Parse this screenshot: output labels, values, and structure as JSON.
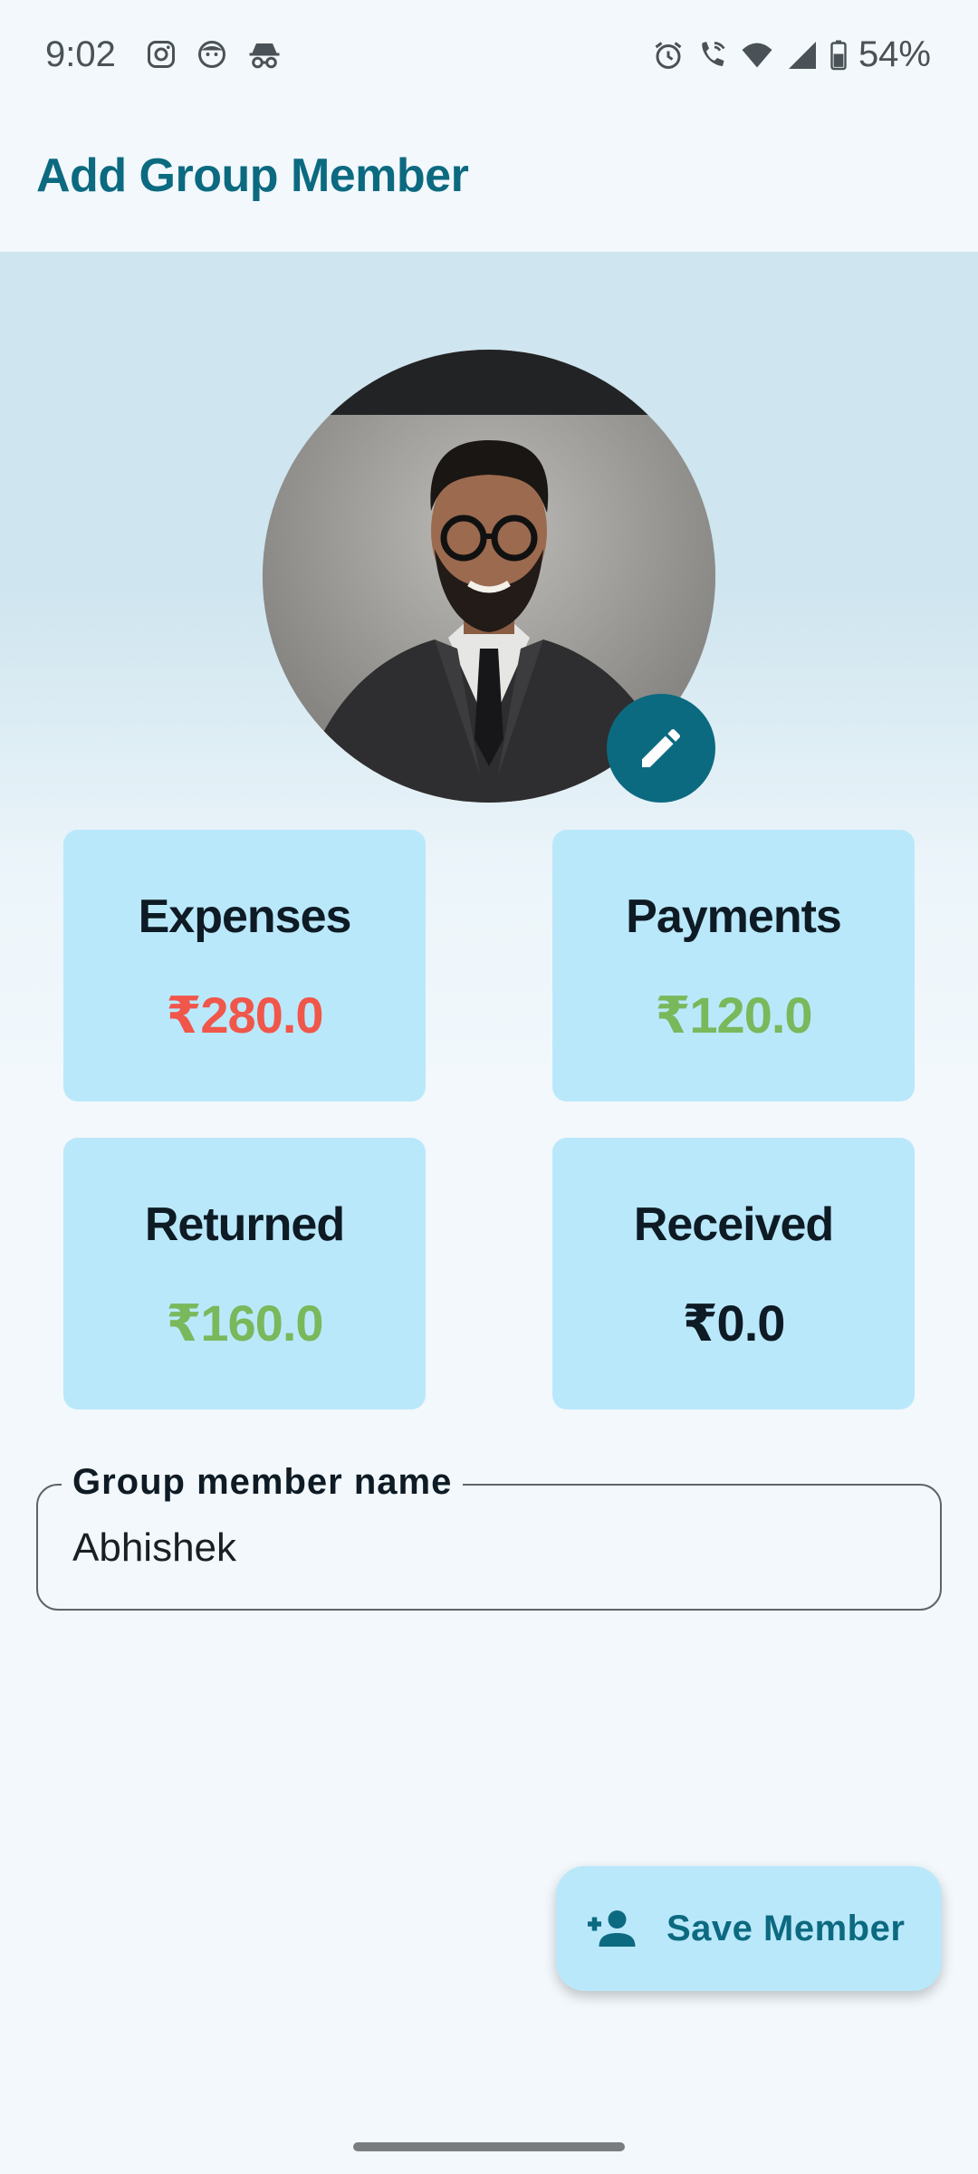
{
  "status_bar": {
    "time": "9:02",
    "battery": "54%",
    "left_icons": [
      "instagram-icon",
      "face-icon",
      "incognito-icon"
    ],
    "right_icons": [
      "alarm-icon",
      "wifi-call-icon",
      "wifi-icon",
      "signal-icon",
      "battery-icon"
    ]
  },
  "app_bar": {
    "title": "Add Group Member"
  },
  "avatar": {
    "edit_icon": "pencil-icon"
  },
  "stats": {
    "expenses": {
      "label": "Expenses",
      "value": "₹280.0",
      "color": "#f0564a"
    },
    "payments": {
      "label": "Payments",
      "value": "₹120.0",
      "color": "#7ab85c"
    },
    "returned": {
      "label": "Returned",
      "value": "₹160.0",
      "color": "#7ab85c"
    },
    "received": {
      "label": "Received",
      "value": "₹0.0",
      "color": "#0e1b24"
    }
  },
  "name_field": {
    "label": "Group member name",
    "value": "Abhishek"
  },
  "save_button": {
    "label": "Save Member",
    "icon": "person-add-icon"
  },
  "colors": {
    "accent": "#0c6a80",
    "card_bg": "#bae8fb",
    "background": "#f2f8fc"
  }
}
